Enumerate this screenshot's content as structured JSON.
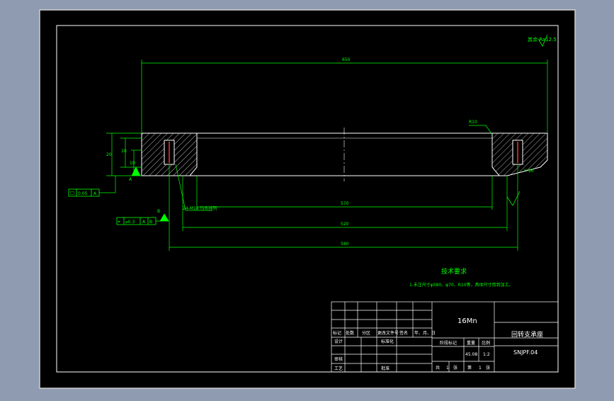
{
  "colors": {
    "viewport_bg": "#8f9bb0",
    "paper": "#000000",
    "frame": "#ffffff",
    "dimension": "#00ff00",
    "annotation": "#00ff00",
    "geometry": "#ffffff",
    "hidden": "#ff3030",
    "title_text": "#ffffff"
  },
  "drawing": {
    "roughness_corner": "其余 Ra12.5",
    "dimensions": {
      "overall_top": "650",
      "bore": "570",
      "bolt_circle": "520",
      "outer_bottom": "580",
      "height_total": "20",
      "height_a": "10",
      "height_b": "10",
      "hole_note": "24-M16 均布排列",
      "chamfer_label": "R10",
      "right_small": "10"
    },
    "gdt_flatness": [
      "☐",
      "0.05",
      "A"
    ],
    "gdt_position": [
      "⌖",
      "⌀0.3",
      "A",
      "B"
    ],
    "datum_a": "A",
    "datum_b": "B",
    "tech_title": "技术要求",
    "tech_note": "1.未注尺寸φ580、φ70、R10等，具体尺寸用到加工。"
  },
  "title_block": {
    "material": "16Mn",
    "part_name": "回转支承座",
    "drawing_no": "SNJPF.04",
    "sign_headers": [
      "标记",
      "处数",
      "分区",
      "更改文件号",
      "签名",
      "年、月、日"
    ],
    "roles": [
      "设计",
      "标准化",
      "审核",
      "工艺",
      "批准"
    ],
    "stage_headers": [
      "阶段标记",
      "重量",
      "比例"
    ],
    "scale": "1:2",
    "weight": "45.08",
    "sheet_info": [
      "共",
      "1",
      "张",
      "第",
      "1",
      "张"
    ]
  }
}
